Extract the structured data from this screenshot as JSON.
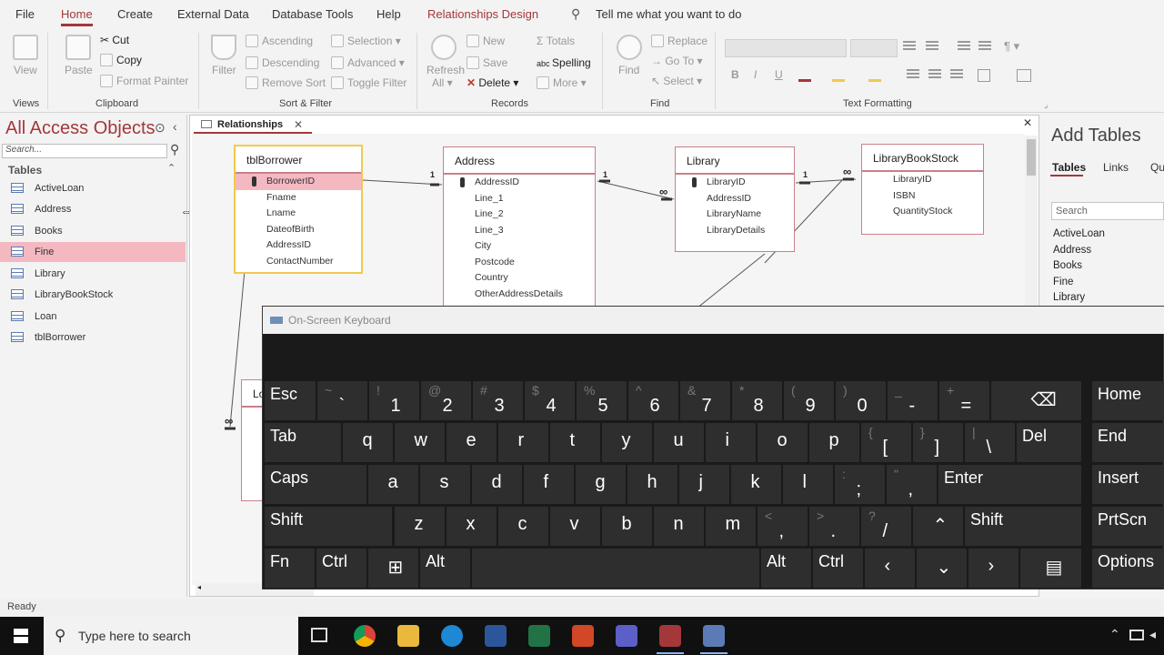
{
  "ribbon_tabs": [
    "File",
    "Home",
    "Create",
    "External Data",
    "Database Tools",
    "Help",
    "Relationships Design"
  ],
  "tell_me": "Tell me what you want to do",
  "ribbon": {
    "views": {
      "view": "View",
      "label": "Views"
    },
    "clipboard": {
      "paste": "Paste",
      "cut": "Cut",
      "copy": "Copy",
      "format_painter": "Format Painter",
      "label": "Clipboard"
    },
    "sort_filter": {
      "filter": "Filter",
      "ascending": "Ascending",
      "descending": "Descending",
      "remove_sort": "Remove Sort",
      "selection": "Selection",
      "advanced": "Advanced",
      "toggle_filter": "Toggle Filter",
      "label": "Sort & Filter"
    },
    "records": {
      "refresh": "Refresh",
      "all": "All",
      "new": "New",
      "save": "Save",
      "delete": "Delete",
      "totals": "Totals",
      "spelling": "Spelling",
      "more": "More",
      "label": "Records"
    },
    "find": {
      "find": "Find",
      "replace": "Replace",
      "goto": "Go To",
      "select": "Select",
      "label": "Find"
    },
    "text_formatting": {
      "bold": "B",
      "italic": "I",
      "underline": "U",
      "label": "Text Formatting"
    }
  },
  "nav": {
    "title": "All Access Objects",
    "search_placeholder": "Search...",
    "section": "Tables",
    "items": [
      "ActiveLoan",
      "Address",
      "Books",
      "Fine",
      "Library",
      "LibraryBookStock",
      "Loan",
      "tblBorrower"
    ]
  },
  "doc_tab": "Relationships",
  "tables": {
    "borrower": {
      "name": "tblBorrower",
      "fields": [
        "BorrowerID",
        "Fname",
        "Lname",
        "DateofBirth",
        "AddressID",
        "ContactNumber"
      ]
    },
    "address": {
      "name": "Address",
      "fields": [
        "AddressID",
        "Line_1",
        "Line_2",
        "Line_3",
        "City",
        "Postcode",
        "Country",
        "OtherAddressDetails"
      ]
    },
    "library": {
      "name": "Library",
      "fields": [
        "LibraryID",
        "AddressID",
        "LibraryName",
        "LibraryDetails"
      ]
    },
    "stock": {
      "name": "LibraryBookStock",
      "fields": [
        "LibraryID",
        "ISBN",
        "QuantityStock"
      ]
    },
    "loan_partial": "Lo"
  },
  "rel_labels": {
    "one": "1",
    "many": "∞"
  },
  "add_tables": {
    "title": "Add Tables",
    "tabs": [
      "Tables",
      "Links",
      "Qu"
    ],
    "search_placeholder": "Search",
    "items": [
      "ActiveLoan",
      "Address",
      "Books",
      "Fine",
      "Library"
    ]
  },
  "osk": {
    "title": "On-Screen Keyboard",
    "row1": [
      [
        "Esc",
        ""
      ],
      [
        "`",
        "~"
      ],
      [
        "1",
        "!"
      ],
      [
        "2",
        "@"
      ],
      [
        "3",
        "#"
      ],
      [
        "4",
        "$"
      ],
      [
        "5",
        "%"
      ],
      [
        "6",
        "^"
      ],
      [
        "7",
        "&"
      ],
      [
        "8",
        "*"
      ],
      [
        "9",
        "("
      ],
      [
        "0",
        ")"
      ],
      [
        "-",
        "_"
      ],
      [
        "=",
        "+"
      ]
    ],
    "row2": [
      "Tab",
      "q",
      "w",
      "e",
      "r",
      "t",
      "y",
      "u",
      "i",
      "o",
      "p"
    ],
    "row2_extra": [
      [
        "[",
        "{"
      ],
      [
        "]",
        "}"
      ],
      [
        "\\",
        "|"
      ],
      [
        "Del",
        ""
      ]
    ],
    "row3": [
      "Caps",
      "a",
      "s",
      "d",
      "f",
      "g",
      "h",
      "j",
      "k",
      "l"
    ],
    "row3_extra": [
      [
        ";",
        ":"
      ],
      [
        ",",
        "\""
      ],
      [
        "Enter",
        ""
      ]
    ],
    "row4": [
      "Shift",
      "z",
      "x",
      "c",
      "v",
      "b",
      "n",
      "m"
    ],
    "row4_extra": [
      [
        ",",
        "<"
      ],
      [
        ".",
        ">"
      ],
      [
        "/",
        "?"
      ],
      [
        "Shift",
        ""
      ]
    ],
    "row5": [
      "Fn",
      "Ctrl",
      "Alt",
      "Alt",
      "Ctrl"
    ],
    "side": [
      "Home",
      "End",
      "Insert",
      "PrtScn",
      "Options"
    ]
  },
  "status": "Ready",
  "taskbar": {
    "search": "Type here to search"
  }
}
